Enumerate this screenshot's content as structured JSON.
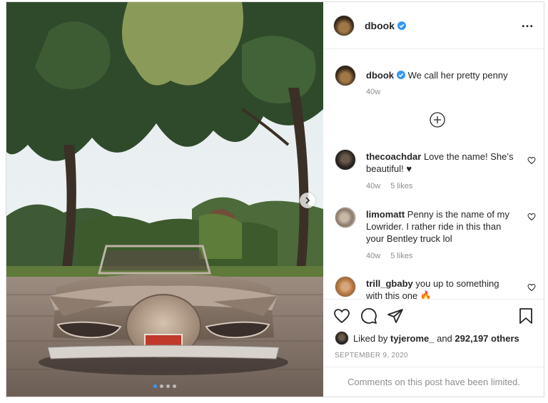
{
  "post": {
    "username": "dbook",
    "verified": true,
    "more_icon": "…"
  },
  "carousel": {
    "slide_count": 4,
    "active_slide": 1
  },
  "caption": {
    "username": "dbook",
    "text": "We call her pretty penny",
    "age": "40w"
  },
  "comments": [
    {
      "username": "thecoachdar",
      "text": "Love the name! She’s beautiful! ♥",
      "age": "40w",
      "likes": "5 likes"
    },
    {
      "username": "limomatt",
      "text": "Penny is the name of my Lowrider. I rather ride in this than your Bentley truck lol",
      "age": "40w",
      "likes": "5 likes"
    },
    {
      "username": "trill_gbaby",
      "text": "you up to something with this one 🔥",
      "age": "",
      "likes": ""
    }
  ],
  "likes": {
    "prefix": "Liked by",
    "user": "tyjerome_",
    "and": "and",
    "count": "292,197 others"
  },
  "date": "SEPTEMBER 9, 2020",
  "comments_limited": "Comments on this post have been limited.",
  "colors": {
    "verified": "#3897f0",
    "text": "#262626",
    "muted": "#8e8e8e",
    "border": "#dbdbdb"
  }
}
